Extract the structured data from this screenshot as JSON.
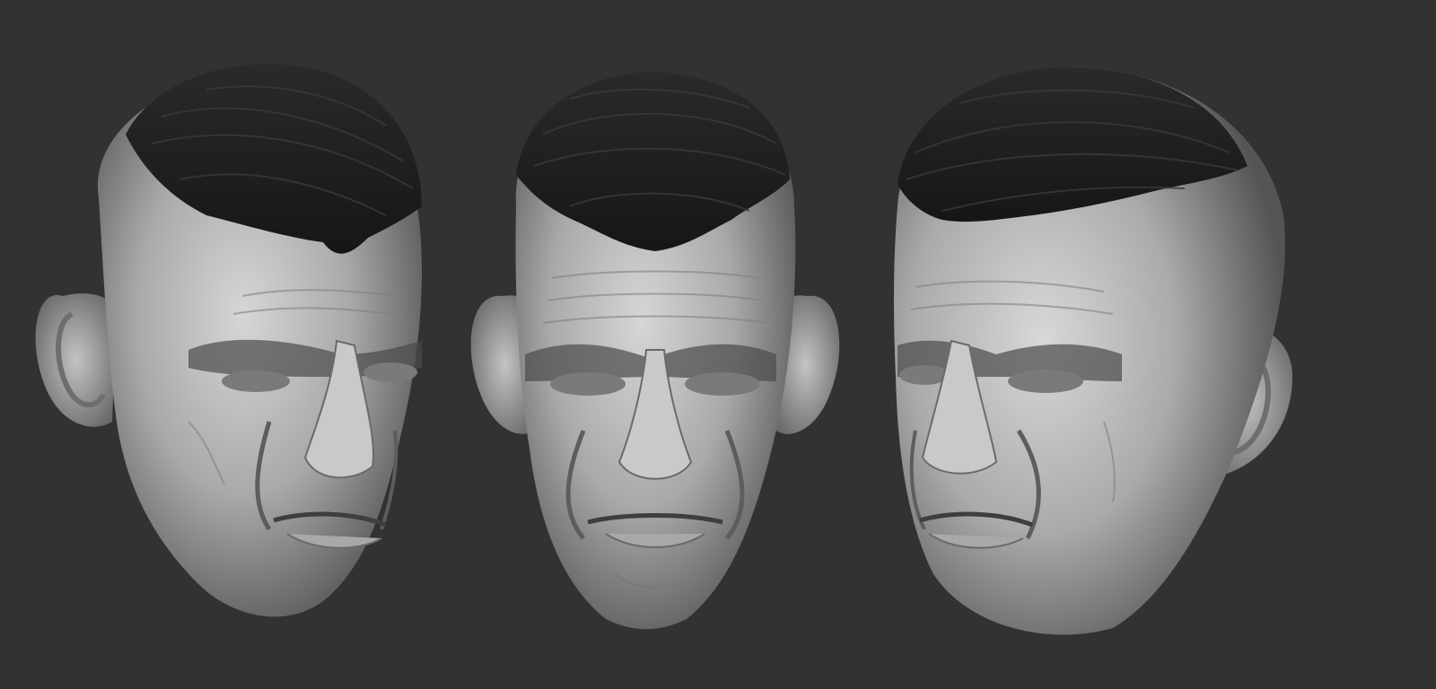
{
  "scene": {
    "background_color": "#323232",
    "skin_color": "#bdbdbd",
    "hair_color": "#1e1e1e",
    "views": [
      {
        "id": "three-quarter-left",
        "icon": "sculpted-head-three-quarter-left"
      },
      {
        "id": "front",
        "icon": "sculpted-head-front"
      },
      {
        "id": "three-quarter-right",
        "icon": "sculpted-head-three-quarter-right"
      }
    ]
  }
}
